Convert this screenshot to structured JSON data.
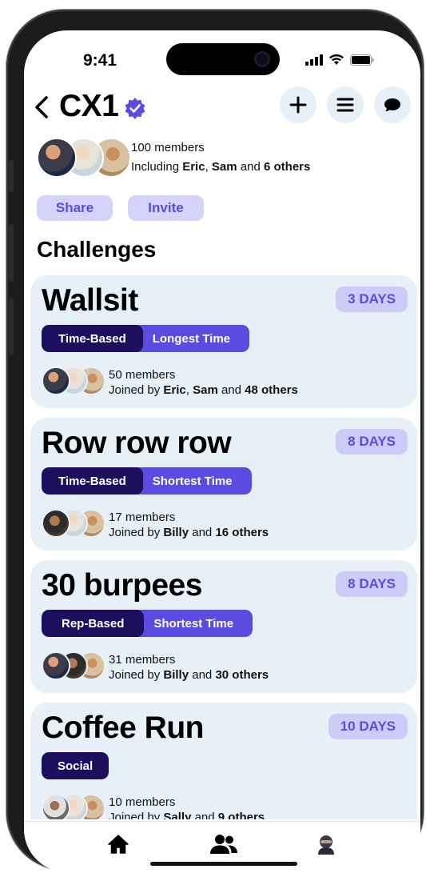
{
  "status_bar": {
    "time": "9:41"
  },
  "header": {
    "title": "CX1"
  },
  "members": {
    "count_text": "100 members",
    "including_prefix": "Including ",
    "name1": "Eric",
    "sep": ", ",
    "name2": "Sam",
    "and": " and ",
    "others": "6 others"
  },
  "actions": {
    "share_label": "Share",
    "invite_label": "Invite"
  },
  "section_title": "Challenges",
  "challenges": [
    {
      "title": "Wallsit",
      "days": "3 DAYS",
      "tag1": "Time-Based",
      "tag2": "Longest Time",
      "members": "50 members",
      "joined_prefix": "Joined by ",
      "name1": "Eric",
      "sep": ", ",
      "name2": "Sam",
      "and": " and ",
      "others": "48 others"
    },
    {
      "title": "Row row row",
      "days": "8 DAYS",
      "tag1": "Time-Based",
      "tag2": "Shortest Time",
      "members": "17 members",
      "joined_prefix": "Joined by ",
      "name1": "Billy",
      "and": " and ",
      "others": "16 others"
    },
    {
      "title": "30 burpees",
      "days": "8 DAYS",
      "tag1": "Rep-Based",
      "tag2": "Shortest Time",
      "members": "31 members",
      "joined_prefix": "Joined by ",
      "name1": "Billy",
      "and": " and ",
      "others": "30 others"
    },
    {
      "title": "Coffee Run",
      "days": "10 DAYS",
      "tag1": "Social",
      "members": "10 members",
      "joined_prefix": "Joined by ",
      "name1": "Sally",
      "and": " and ",
      "others": "9 others"
    }
  ],
  "tabbar": {
    "items": [
      "home-icon",
      "group-icon",
      "profile-avatar"
    ]
  },
  "colors": {
    "accent": "#5b4bdf",
    "accent_light": "#d6d3fa",
    "dark_tag": "#1c0f5e",
    "card_bg": "#e8f0f7"
  }
}
